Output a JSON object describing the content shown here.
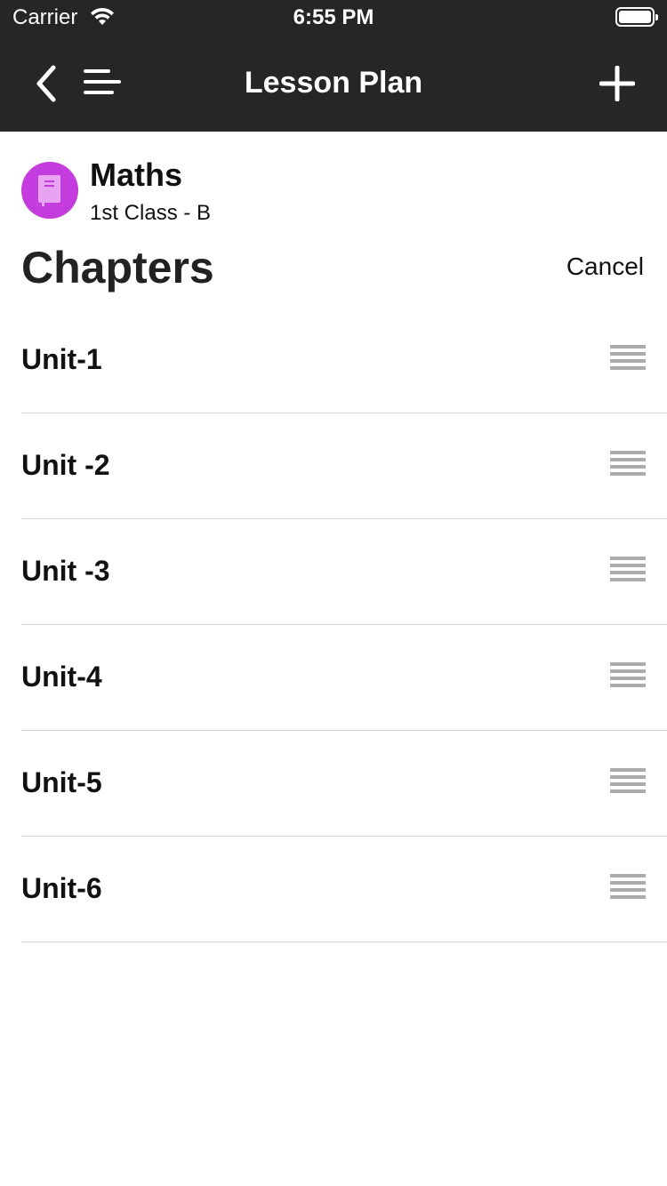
{
  "status_bar": {
    "carrier": "Carrier",
    "time": "6:55 PM"
  },
  "nav": {
    "title": "Lesson Plan",
    "back_icon": "chevron-left-icon",
    "menu_icon": "menu-icon",
    "add_icon": "plus-icon"
  },
  "subject": {
    "name": "Maths",
    "class_label": "1st Class - B",
    "avatar_color": "#c53cde",
    "icon": "book-icon"
  },
  "chapters": {
    "heading": "Chapters",
    "cancel_label": "Cancel",
    "items": [
      {
        "label": "Unit-1"
      },
      {
        "label": "Unit -2"
      },
      {
        "label": "Unit -3"
      },
      {
        "label": "Unit-4"
      },
      {
        "label": "Unit-5"
      },
      {
        "label": "Unit-6"
      }
    ]
  },
  "colors": {
    "bar_background": "#262626",
    "divider": "#d4d4d4",
    "drag_handle": "#ababab"
  }
}
